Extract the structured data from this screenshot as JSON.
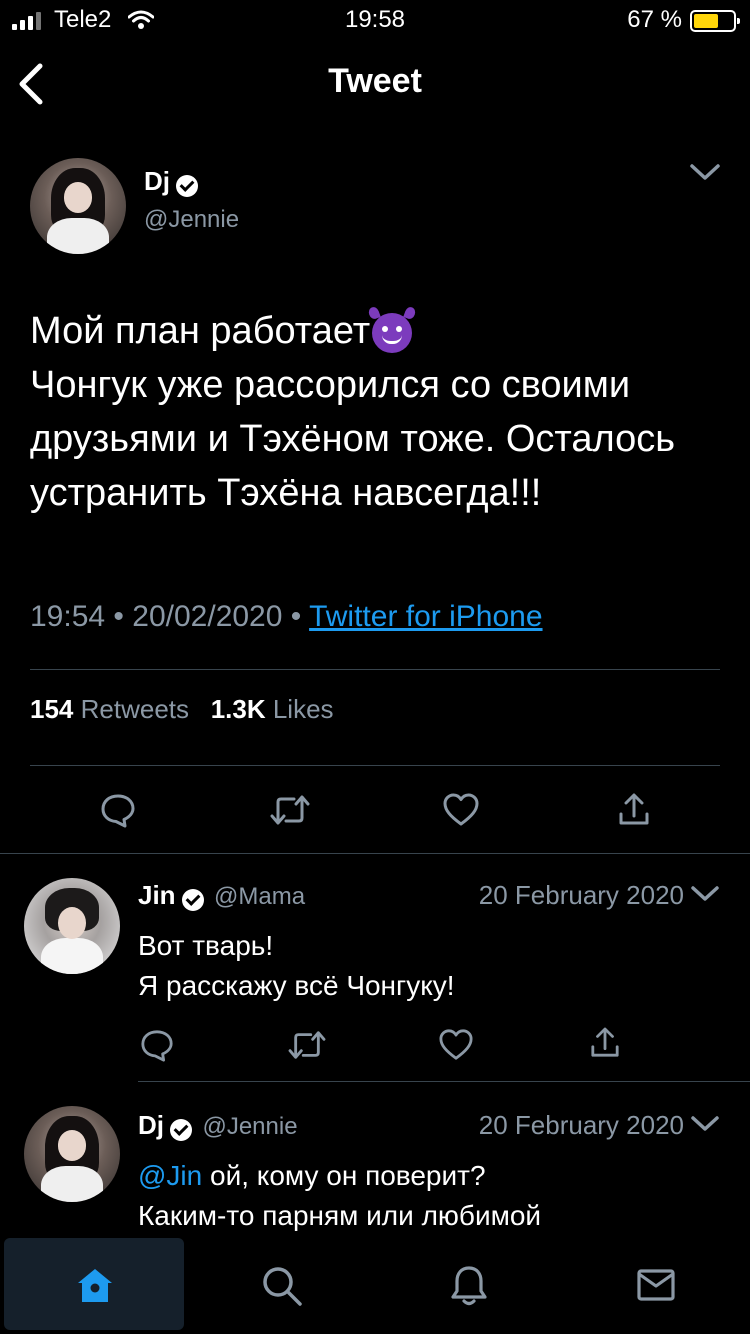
{
  "status_bar": {
    "carrier": "Tele2",
    "time": "19:58",
    "battery_percent": "67 %",
    "battery_level": 0.67
  },
  "header": {
    "title": "Tweet"
  },
  "tweet": {
    "author_name": "Dj",
    "author_handle": "@Jennie",
    "text_line1": "Мой план работает",
    "text_rest": "Чонгук уже рассорился со своими друзьями и Тэхёном тоже. Осталось устранить Тэхёна навсегда!!!",
    "time": "19:54",
    "date": "20/02/2020",
    "separator": "•",
    "source": "Twitter for iPhone",
    "retweets_count": "154",
    "retweets_label": "Retweets",
    "likes_count": "1.3K",
    "likes_label": "Likes"
  },
  "replies": [
    {
      "name": "Jin",
      "handle": "@Mama",
      "date": "20 February 2020",
      "line1": "Вот тварь!",
      "line2": "Я расскажу всё Чонгуку!"
    },
    {
      "name": "Dj",
      "handle": "@Jennie",
      "date": "20 February 2020",
      "mention": "@Jin",
      "line1_rest": " ой, кому он поверит?",
      "line2": "Каким-то парням или любимой"
    }
  ],
  "icons": {
    "back": "chevron-left-icon",
    "reply": "comment-icon",
    "retweet": "retweet-icon",
    "like": "heart-icon",
    "share": "share-icon",
    "home": "home-icon",
    "search": "search-icon",
    "notifications": "bell-icon",
    "messages": "mail-icon"
  },
  "colors": {
    "accent": "#1d9bf0",
    "muted": "#8b98a5",
    "battery": "#ffd60a"
  }
}
